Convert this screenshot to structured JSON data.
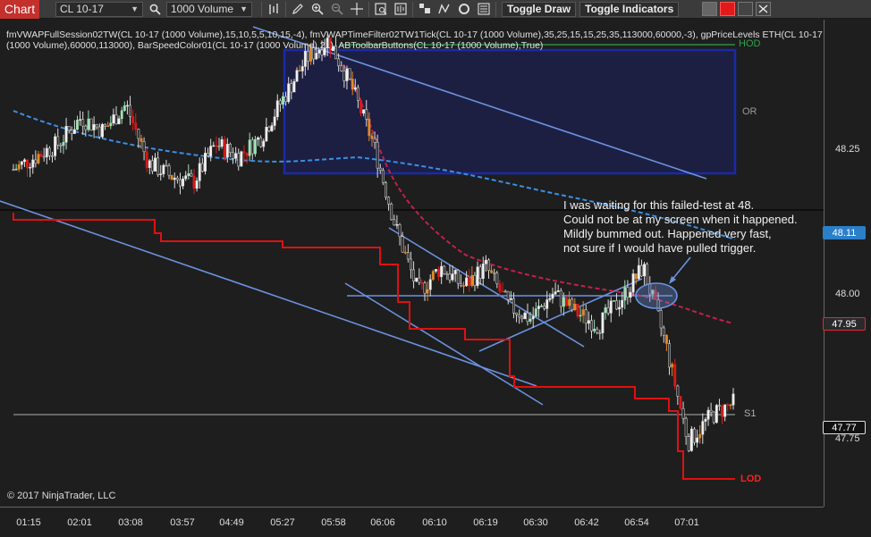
{
  "toolbar": {
    "tab_label": "Chart",
    "instrument": "CL 10-17",
    "period": "1000 Volume",
    "toggle_draw": "Toggle Draw",
    "toggle_indicators": "Toggle Indicators"
  },
  "legend": {
    "line1": "fmVWAPFullSession02TW(CL 10-17 (1000 Volume),15,10,5,5,10,15,-4), fmVWAPTimeFilter02TW1Tick(CL 10-17 (1000 Volume),35,25,15,15,25,35,113000,60000,-3), gpPriceLevels ETH(CL 10-17",
    "line2": "(1000 Volume),60000,113000), BarSpeedColor01(CL 10-17 (1000 Volume),21), ABToolbarButtons(CL 10-17 (1000 Volume),True)"
  },
  "copyright": "© 2017 NinjaTrader, LLC",
  "price_axis": {
    "ticks": [
      "48.25",
      "48.00",
      "47.75"
    ],
    "current_price": "48.11",
    "marker_red": "47.95",
    "marker_white": "47.77"
  },
  "time_axis": [
    "01:15",
    "02:01",
    "03:08",
    "03:57",
    "04:49",
    "05:27",
    "05:58",
    "06:06",
    "06:10",
    "06:19",
    "06:30",
    "06:42",
    "06:54",
    "07:01"
  ],
  "levels": {
    "hod": "HOD",
    "or": "OR",
    "s1": "S1",
    "lod": "LOD"
  },
  "annotation": {
    "lines": [
      "I was waiting for this failed-test at 48.",
      "Could not be at my screen when it happened.",
      "Mildly bummed out. Happened very fast,",
      "not sure if I would have pulled trigger."
    ]
  },
  "colors": {
    "tab": "#c4302b",
    "current_price": "#2b7fc9",
    "red_marker": "#e0283a",
    "hod": "#2fa34a",
    "lod": "#e01a1a",
    "or_box": "#1a2aa8",
    "trendline": "#6b92e0",
    "vwap_blue": "#3a8fe6",
    "vwap_red": "#c4204a",
    "stop_line": "#e01010"
  },
  "chart_data": {
    "type": "candlestick",
    "instrument": "CL 10-17",
    "period": "1000 Volume",
    "y_ticks": [
      48.25,
      48.0,
      47.75
    ],
    "ylim": [
      47.63,
      48.36
    ],
    "x_labels": [
      "01:15",
      "02:01",
      "03:08",
      "03:57",
      "04:49",
      "05:27",
      "05:58",
      "06:06",
      "06:10",
      "06:19",
      "06:30",
      "06:42",
      "06:54",
      "07:01"
    ],
    "levels": [
      {
        "name": "HOD",
        "value": 48.335
      },
      {
        "name": "S1",
        "value": 47.78
      },
      {
        "name": "LOD",
        "value": 47.66
      }
    ],
    "current_price": 48.11,
    "marker_red": 47.95,
    "marker_white": 47.77,
    "price_path": [
      {
        "t": 0,
        "p": 48.14
      },
      {
        "t": 1,
        "p": 48.16
      },
      {
        "t": 2,
        "p": 48.18
      },
      {
        "t": 3,
        "p": 48.22
      },
      {
        "t": 4,
        "p": 48.2
      },
      {
        "t": 5,
        "p": 48.24
      },
      {
        "t": 6,
        "p": 48.15
      },
      {
        "t": 7,
        "p": 48.13
      },
      {
        "t": 8,
        "p": 48.12
      },
      {
        "t": 9,
        "p": 48.18
      },
      {
        "t": 10,
        "p": 48.16
      },
      {
        "t": 11,
        "p": 48.19
      },
      {
        "t": 12,
        "p": 48.25
      },
      {
        "t": 13,
        "p": 48.31
      },
      {
        "t": 14,
        "p": 48.34
      },
      {
        "t": 15,
        "p": 48.27
      },
      {
        "t": 16,
        "p": 48.18
      },
      {
        "t": 17,
        "p": 48.05
      },
      {
        "t": 18,
        "p": 47.95
      },
      {
        "t": 19,
        "p": 47.99
      },
      {
        "t": 20,
        "p": 47.96
      },
      {
        "t": 21,
        "p": 47.99
      },
      {
        "t": 22,
        "p": 47.93
      },
      {
        "t": 23,
        "p": 47.91
      },
      {
        "t": 24,
        "p": 47.95
      },
      {
        "t": 25,
        "p": 47.92
      },
      {
        "t": 26,
        "p": 47.9
      },
      {
        "t": 27,
        "p": 47.94
      },
      {
        "t": 28,
        "p": 47.99
      },
      {
        "t": 29,
        "p": 47.87
      },
      {
        "t": 30,
        "p": 47.72
      },
      {
        "t": 31,
        "p": 47.76
      },
      {
        "t": 32,
        "p": 47.78
      }
    ]
  }
}
